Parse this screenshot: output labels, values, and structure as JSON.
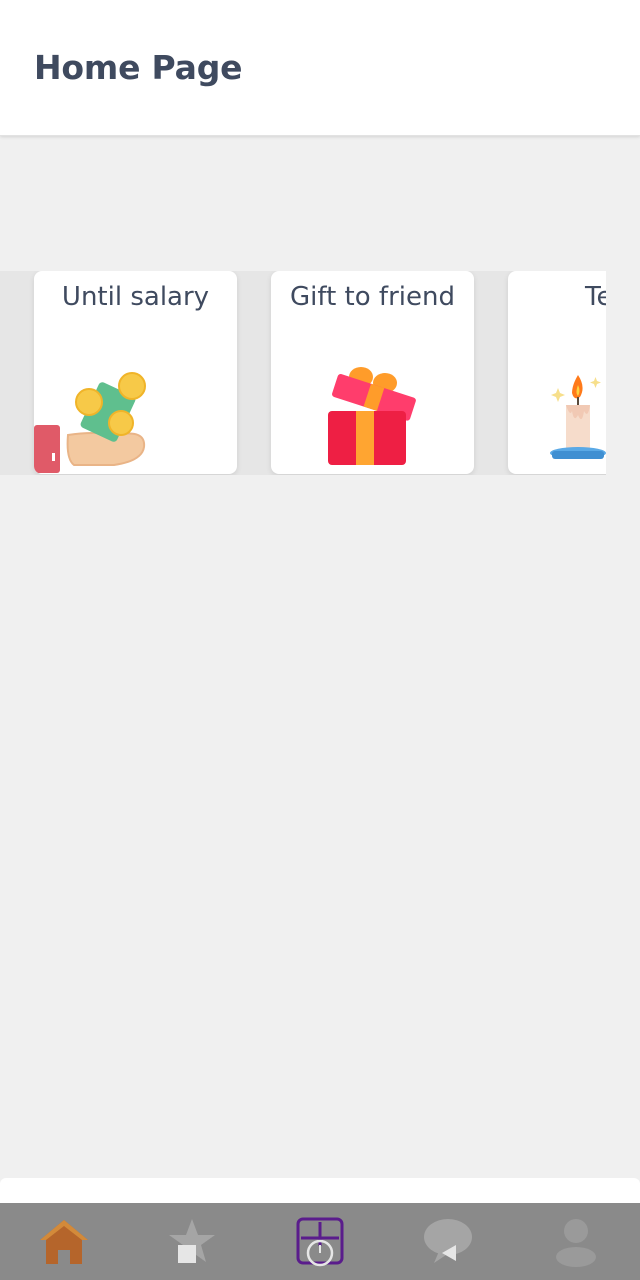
{
  "header": {
    "title": "Home Page"
  },
  "cards": [
    {
      "label": "Until salary",
      "icon": "money-hand-icon"
    },
    {
      "label": "Gift to friend",
      "icon": "gift-box-icon"
    },
    {
      "label": "Te",
      "icon": "candle-icon"
    }
  ],
  "bottom_nav": {
    "items": [
      {
        "name": "home",
        "icon": "home-icon",
        "active": true
      },
      {
        "name": "favorites",
        "icon": "star-icon",
        "active": false
      },
      {
        "name": "timer",
        "icon": "timer-icon",
        "active": false
      },
      {
        "name": "messages",
        "icon": "chat-icon",
        "active": false
      },
      {
        "name": "profile",
        "icon": "profile-icon",
        "active": false
      }
    ]
  },
  "colors": {
    "header_text": "#3f4a5f",
    "background": "#f0f0f0",
    "nav_background": "#8a8a8a",
    "home_active": "#b5652b",
    "timer_accent": "#5a1c8c"
  }
}
